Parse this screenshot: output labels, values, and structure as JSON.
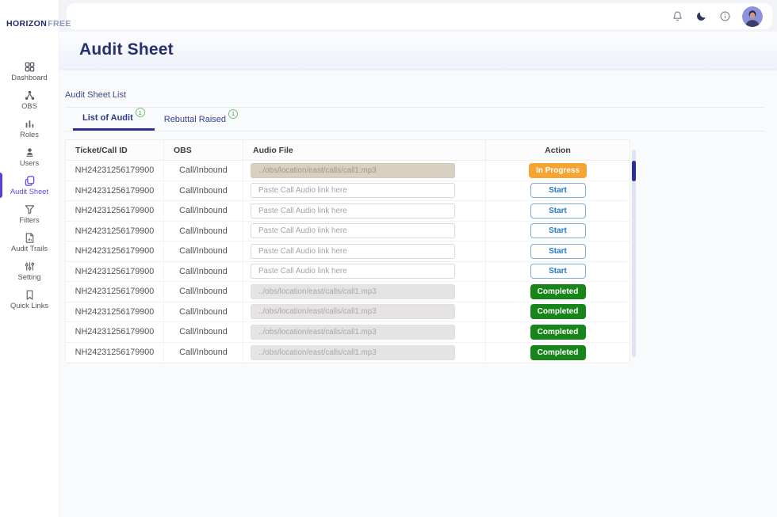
{
  "logo": {
    "primary": "HORIZON",
    "secondary": "FREE"
  },
  "topbar": {
    "icons": [
      "notifications-icon",
      "dark-mode-icon",
      "info-icon",
      "user-avatar"
    ]
  },
  "sidebar": {
    "items": [
      {
        "label": "Dashboard",
        "icon": "dashboard-icon",
        "active": false
      },
      {
        "label": "OBS",
        "icon": "obs-icon",
        "active": false
      },
      {
        "label": "Roles",
        "icon": "roles-icon",
        "active": false
      },
      {
        "label": "Users",
        "icon": "users-icon",
        "active": false
      },
      {
        "label": "Audit Sheet",
        "icon": "audit-sheet-icon",
        "active": true
      },
      {
        "label": "Filters",
        "icon": "filters-icon",
        "active": false
      },
      {
        "label": "Audit Trails",
        "icon": "audit-trails-icon",
        "active": false
      },
      {
        "label": "Setting",
        "icon": "setting-icon",
        "active": false
      },
      {
        "label": "Quick Links",
        "icon": "quick-links-icon",
        "active": false
      }
    ]
  },
  "page": {
    "title": "Audit Sheet",
    "section_label": "Audit Sheet List"
  },
  "tabs": [
    {
      "label": "List of Audit",
      "badge": "1",
      "active": true
    },
    {
      "label": "Rebuttal Raised",
      "badge": "1",
      "active": false
    }
  ],
  "table": {
    "columns": [
      "Ticket/Call ID",
      "OBS",
      "Audio File",
      "Action"
    ],
    "audio_placeholder": "Paste Call Audio link here",
    "rows": [
      {
        "ticket_id": "NH24231256179900",
        "obs": "Call/Inbound",
        "audio_value": "../obs/location/east/calls/call1.mp3",
        "audio_style": "tan",
        "action": "In Progress",
        "action_style": "in-progress"
      },
      {
        "ticket_id": "NH24231256179900",
        "obs": "Call/Inbound",
        "audio_value": "",
        "audio_style": "empty",
        "action": "Start",
        "action_style": "start"
      },
      {
        "ticket_id": "NH24231256179900",
        "obs": "Call/Inbound",
        "audio_value": "",
        "audio_style": "empty",
        "action": "Start",
        "action_style": "start"
      },
      {
        "ticket_id": "NH24231256179900",
        "obs": "Call/Inbound",
        "audio_value": "",
        "audio_style": "empty",
        "action": "Start",
        "action_style": "start"
      },
      {
        "ticket_id": "NH24231256179900",
        "obs": "Call/Inbound",
        "audio_value": "",
        "audio_style": "empty",
        "action": "Start",
        "action_style": "start"
      },
      {
        "ticket_id": "NH24231256179900",
        "obs": "Call/Inbound",
        "audio_value": "",
        "audio_style": "empty",
        "action": "Start",
        "action_style": "start"
      },
      {
        "ticket_id": "NH24231256179900",
        "obs": "Call/Inbound",
        "audio_value": "../obs/location/east/calls/call1.mp3",
        "audio_style": "gray",
        "action": "Completed",
        "action_style": "completed"
      },
      {
        "ticket_id": "NH24231256179900",
        "obs": "Call/Inbound",
        "audio_value": "../obs/location/east/calls/call1.mp3",
        "audio_style": "gray",
        "action": "Completed",
        "action_style": "completed"
      },
      {
        "ticket_id": "NH24231256179900",
        "obs": "Call/Inbound",
        "audio_value": "../obs/location/east/calls/call1.mp3",
        "audio_style": "gray",
        "action": "Completed",
        "action_style": "completed"
      },
      {
        "ticket_id": "NH24231256179900",
        "obs": "Call/Inbound",
        "audio_value": "../obs/location/east/calls/call1.mp3",
        "audio_style": "gray",
        "action": "Completed",
        "action_style": "completed"
      }
    ]
  },
  "colors": {
    "in_progress_orange": "#f6a432",
    "start_blue": "#2478cd",
    "completed_green": "#17851a",
    "badge_green": "#3f9e44",
    "active_nav_purple": "#5b4be0",
    "title_navy": "#26306e",
    "scroll_thumb_navy": "#2b2e9b"
  }
}
